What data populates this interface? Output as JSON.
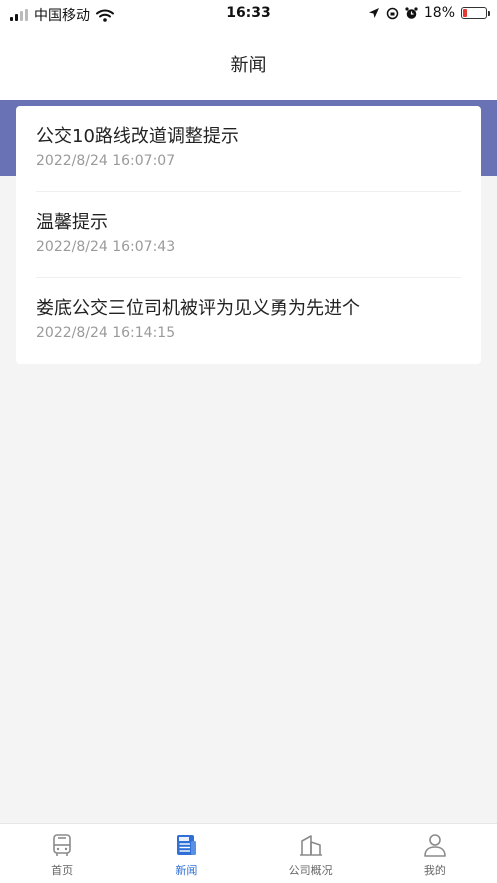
{
  "status_bar": {
    "carrier": "中国移动",
    "time": "16:33",
    "battery": "18%",
    "battery_level": 0.18,
    "icons": [
      "signal-icon",
      "wifi-icon",
      "location-icon",
      "lock-rotation-icon",
      "alarm-icon",
      "battery-icon"
    ]
  },
  "header": {
    "title": "新闻"
  },
  "news": [
    {
      "title": "公交10路线改道调整提示",
      "time": "2022/8/24 16:07:07"
    },
    {
      "title": "温馨提示",
      "time": "2022/8/24 16:07:43"
    },
    {
      "title": "娄底公交三位司机被评为见义勇为先进个",
      "time": "2022/8/24 16:14:15"
    }
  ],
  "tabs": [
    {
      "label": "首页",
      "icon": "bus-icon",
      "active": false
    },
    {
      "label": "新闻",
      "icon": "news-icon",
      "active": true
    },
    {
      "label": "公司概况",
      "icon": "building-icon",
      "active": false
    },
    {
      "label": "我的",
      "icon": "user-icon",
      "active": false
    }
  ],
  "colors": {
    "accent": "#2f6fd6",
    "band": "#6a72b6",
    "battery_low": "#e53935"
  }
}
